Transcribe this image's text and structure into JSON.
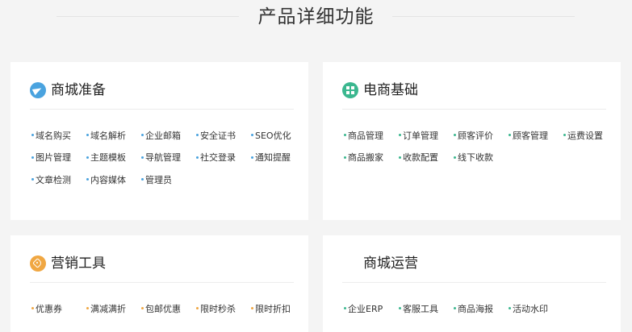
{
  "page": {
    "section_title": "产品详细功能"
  },
  "colors": {
    "blue": "#4aa3df",
    "green": "#3bb78f",
    "orange": "#f0a742"
  },
  "cards": {
    "mall_prep": {
      "title": "商城准备",
      "icon": "paper-plane-icon",
      "rows": [
        [
          "域名购买",
          "域名解析",
          "企业邮箱",
          "安全证书",
          "SEO优化"
        ],
        [
          "图片管理",
          "主题模板",
          "导航管理",
          "社交登录",
          "通知提醒"
        ],
        [
          "文章检测",
          "内容媒体",
          "管理员"
        ]
      ]
    },
    "ecom_basic": {
      "title": "电商基础",
      "icon": "grid-icon",
      "rows": [
        [
          "商品管理",
          "订单管理",
          "顾客评价",
          "顾客管理",
          "运费设置"
        ],
        [
          "商品搬家",
          "收款配置",
          "线下收款"
        ]
      ]
    },
    "marketing": {
      "title": "营销工具",
      "icon": "tag-icon",
      "rows": [
        [
          "优惠券",
          "满减满折",
          "包邮优惠",
          "限时秒杀",
          "限时折扣"
        ]
      ]
    },
    "operations": {
      "title": "商城运营",
      "icon": "",
      "rows": [
        [
          "企业ERP",
          "客服工具",
          "商品海报",
          "活动水印"
        ]
      ]
    }
  }
}
